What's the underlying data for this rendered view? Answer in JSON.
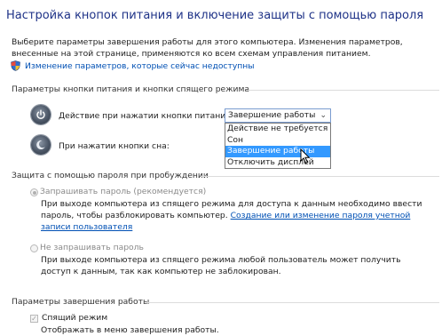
{
  "page": {
    "title": "Настройка кнопок питания и включение защиты с помощью пароля",
    "intro": "Выберите параметры завершения работы для этого компьютера. Изменения параметров, внесенные на этой странице, применяются ко всем схемам управления питанием.",
    "change_unavailable_link": "Изменение параметров, которые сейчас недоступны"
  },
  "power_buttons": {
    "section_title": "Параметры кнопки питания и кнопки спящего режима",
    "power_label": "Действие при нажатии кнопки питания:",
    "power_value": "Завершение работы",
    "sleep_label": "При нажатии кнопки сна:",
    "options": [
      "Действие не требуется",
      "Сон",
      "Завершение работы",
      "Отключить дисплей"
    ],
    "selected_index": 2
  },
  "password": {
    "section_title": "Защита с помощью пароля при пробуждении",
    "require_label": "Запрашивать пароль (рекомендуется)",
    "require_desc": "При выходе компьютера из спящего режима для доступа к данным необходимо ввести пароль, чтобы разблокировать компьютер.",
    "require_link": "Создание или изменение пароля учетной записи пользователя",
    "no_require_label": "Не запрашивать пароль",
    "no_require_desc": "При выходе компьютера из спящего режима любой пользователь может получить доступ к данным, так как компьютер не заблокирован."
  },
  "shutdown": {
    "section_title": "Параметры завершения работы",
    "sleep_checkbox_label": "Спящий режим",
    "sleep_checkbox_desc": "Отображать в меню завершения работы."
  },
  "colors": {
    "title": "#1e3287",
    "link": "#0050b4",
    "selection": "#3399ff"
  }
}
